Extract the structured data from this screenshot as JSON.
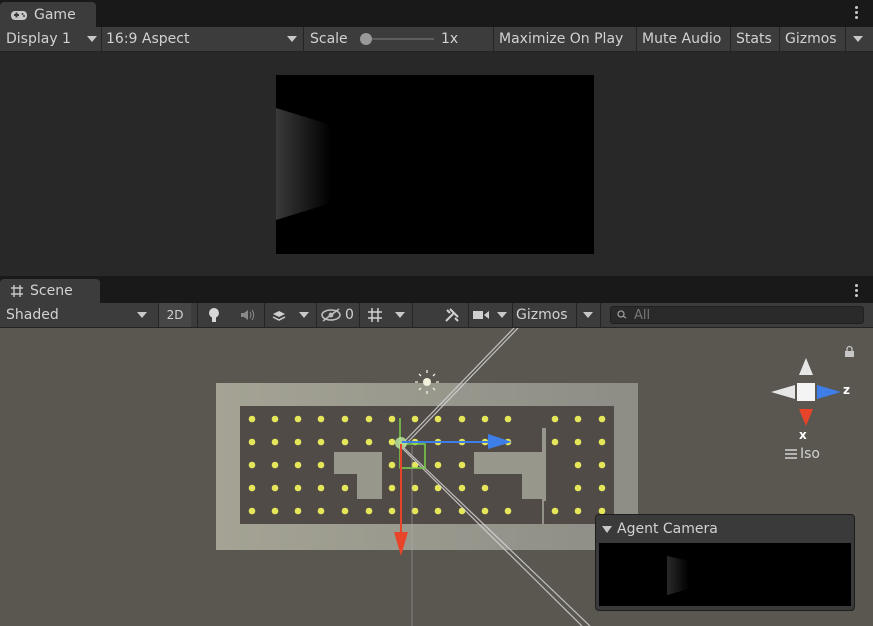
{
  "game": {
    "tab_label": "Game",
    "display": "Display 1",
    "aspect": "16:9 Aspect",
    "scale_label": "Scale",
    "scale_value": "1x",
    "scale_level": 0.0,
    "maximize": "Maximize On Play",
    "mute": "Mute Audio",
    "stats": "Stats",
    "gizmos": "Gizmos"
  },
  "scene": {
    "tab_label": "Scene",
    "shading": "Shaded",
    "mode_2d": "2D",
    "hidden_count": "0",
    "gizmos": "Gizmos",
    "search_placeholder": "All",
    "iso_label": "Iso",
    "axis_x": "x",
    "axis_z": "z",
    "agent_camera_title": "Agent Camera"
  },
  "icons": [
    "gamepad-icon",
    "grid-icon",
    "lightbulb-icon",
    "audio-icon",
    "effects-icon",
    "visibility-icon",
    "grid-snap-icon",
    "tools-icon",
    "camera-icon",
    "search-icon",
    "lock-icon",
    "sun-icon",
    "kebab-menu-icon"
  ],
  "colors": {
    "panel_bg": "#3c3c3c",
    "scene_bg": "#5a5650",
    "floor": "#97978c",
    "wall": "#514b47",
    "pellet": "#e6e65a",
    "x_axis": "#e8442a",
    "y_axis": "#7ad14a",
    "z_axis": "#3d7ee8"
  }
}
